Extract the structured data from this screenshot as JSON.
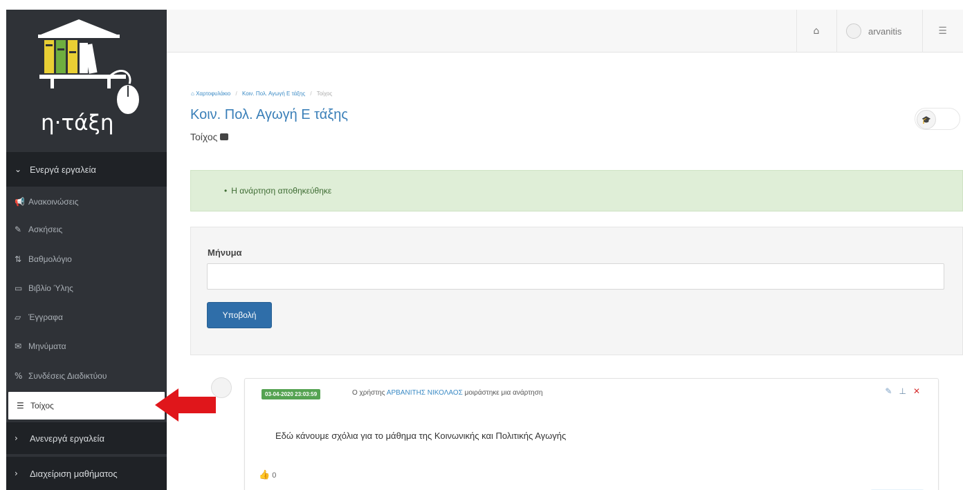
{
  "sidebar": {
    "logo_text": "η·τάξη",
    "active_tools_header": "Ενεργά εργαλεία",
    "items": [
      {
        "label": "Ανακοινώσεις",
        "icon": "bullhorn-icon"
      },
      {
        "label": "Ασκήσεις",
        "icon": "edit-icon"
      },
      {
        "label": "Βαθμολόγιο",
        "icon": "sort-icon"
      },
      {
        "label": "Βιβλίο Ύλης",
        "icon": "calendar-icon"
      },
      {
        "label": "Έγγραφα",
        "icon": "folder-icon"
      },
      {
        "label": "Μηνύματα",
        "icon": "envelope-icon"
      },
      {
        "label": "Συνδέσεις Διαδικτύου",
        "icon": "link-icon"
      },
      {
        "label": "Τοίχος",
        "icon": "list-icon"
      }
    ],
    "inactive_tools_header": "Ανενεργά εργαλεία",
    "course_admin_header": "Διαχείριση μαθήματος"
  },
  "topbar": {
    "username": "arvanitis"
  },
  "breadcrumb": [
    "Χαρτοφυλάκιο",
    "Κοιν. Πολ. Αγωγή Ε τάξης",
    "Τοίχος"
  ],
  "course_title": "Κοιν. Πολ. Αγωγή Ε τάξης",
  "page_subtitle": "Τοίχος",
  "alert": {
    "message": "Η ανάρτηση αποθηκεύθηκε"
  },
  "form": {
    "message_label": "Μήνυμα",
    "message_value": "",
    "submit_label": "Υποβολή"
  },
  "post": {
    "date": "03-04-2020 23:03:59",
    "meta_prefix": "Ο χρήστης",
    "author": "ΑΡΒΑΝΙΤΗΣ ΝΙΚΟΛΑΟΣ",
    "meta_suffix": "μοιράστηκε μια ανάρτηση",
    "text": "Εδώ κάνουμε σχόλια για το μάθημα της Κοινωνικής και Πολιτικής Αγωγής",
    "likes": "0"
  },
  "colors": {
    "sidebar_bg": "#2f3237",
    "sidebar_header_bg": "#1f2226",
    "accent_blue": "#3a7fb8",
    "alert_green_bg": "#dfeed7",
    "date_badge_green": "#55a352",
    "arrow_red": "#e0161b"
  }
}
